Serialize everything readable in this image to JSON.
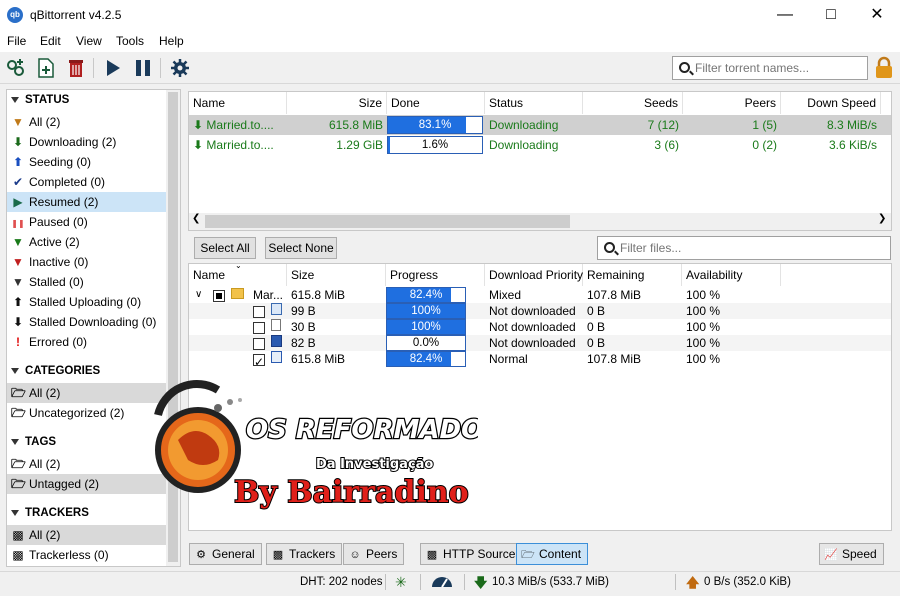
{
  "window": {
    "title": "qBittorrent v4.2.5",
    "app_icon": "qb"
  },
  "menu": [
    "File",
    "Edit",
    "View",
    "Tools",
    "Help"
  ],
  "toolbar": {
    "icons": [
      "add-torrent-link-icon",
      "add-torrent-file-icon",
      "delete-icon",
      "resume-icon",
      "pause-icon",
      "options-gear-icon"
    ],
    "search_placeholder": "Filter torrent names..."
  },
  "sidebar": {
    "status_header": "STATUS",
    "status_items": [
      {
        "label": "All (2)",
        "icon": "filter-icon",
        "color": "#c07a1a"
      },
      {
        "label": "Downloading (2)",
        "icon": "arrow-down-icon",
        "color": "#1a6a1a"
      },
      {
        "label": "Seeding (0)",
        "icon": "arrow-up-icon",
        "color": "#1a4fc0"
      },
      {
        "label": "Completed (0)",
        "icon": "check-icon",
        "color": "#1a3a8a"
      },
      {
        "label": "Resumed (2)",
        "icon": "play-icon",
        "color": "#1a6a4a"
      },
      {
        "label": "Paused (0)",
        "icon": "pause-icon",
        "color": "#e05050"
      },
      {
        "label": "Active (2)",
        "icon": "filter-icon",
        "color": "#1a7a1a"
      },
      {
        "label": "Inactive (0)",
        "icon": "filter-icon",
        "color": "#c02020"
      },
      {
        "label": "Stalled (0)",
        "icon": "filter-icon",
        "color": "#333333"
      },
      {
        "label": "Stalled Uploading (0)",
        "icon": "arrow-up-icon",
        "color": "#111111"
      },
      {
        "label": "Stalled Downloading (0)",
        "icon": "arrow-down-icon",
        "color": "#111111"
      },
      {
        "label": "Errored (0)",
        "icon": "exclamation-icon",
        "color": "#e01010"
      }
    ],
    "categories_header": "CATEGORIES",
    "categories_items": [
      "All (2)",
      "Uncategorized (2)"
    ],
    "tags_header": "TAGS",
    "tags_items": [
      "All (2)",
      "Untagged (2)"
    ],
    "trackers_header": "TRACKERS",
    "trackers_items": [
      "All (2)",
      "Trackerless (0)"
    ]
  },
  "torrents": {
    "columns": [
      "Name",
      "Size",
      "Done",
      "Status",
      "Seeds",
      "Peers",
      "Down Speed"
    ],
    "rows": [
      {
        "name": "Married.to....",
        "size": "615.8 MiB",
        "done": "83.1%",
        "done_value": 0.831,
        "status": "Downloading",
        "seeds": "7 (12)",
        "peers": "1 (5)",
        "down_speed": "8.3 MiB/s"
      },
      {
        "name": "Married.to....",
        "size": "1.29 GiB",
        "done": "1.6%",
        "done_value": 0.016,
        "status": "Downloading",
        "seeds": "3 (6)",
        "peers": "0 (2)",
        "down_speed": "3.6 KiB/s"
      }
    ]
  },
  "content_toolbar": {
    "select_all": "Select All",
    "select_none": "Select None",
    "filter_placeholder": "Filter files..."
  },
  "files": {
    "columns": [
      "Name",
      "Size",
      "Progress",
      "Download Priority",
      "Remaining",
      "Availability"
    ],
    "rows": [
      {
        "name": "Mar...",
        "size": "615.8 MiB",
        "progress": "82.4%",
        "progress_value": 0.824,
        "priority": "Mixed",
        "remaining": "107.8 MiB",
        "availability": "100 %"
      },
      {
        "name": "",
        "size": "99 B",
        "progress": "100%",
        "progress_value": 1.0,
        "priority": "Not downloaded",
        "remaining": "0 B",
        "availability": "100 %"
      },
      {
        "name": "",
        "size": "30 B",
        "progress": "100%",
        "progress_value": 1.0,
        "priority": "Not downloaded",
        "remaining": "0 B",
        "availability": "100 %"
      },
      {
        "name": "",
        "size": "82 B",
        "progress": "0.0%",
        "progress_value": 0.0,
        "priority": "Not downloaded",
        "remaining": "0 B",
        "availability": "100 %"
      },
      {
        "name": "",
        "size": "615.8 MiB",
        "progress": "82.4%",
        "progress_value": 0.824,
        "priority": "Normal",
        "remaining": "107.8 MiB",
        "availability": "100 %"
      }
    ]
  },
  "tabs": [
    "General",
    "Trackers",
    "Peers",
    "HTTP Sources",
    "Content"
  ],
  "speed_button": "Speed",
  "statusbar": {
    "dht": "DHT: 202 nodes",
    "download": "10.3 MiB/s (533.7 MiB)",
    "upload": "0 B/s (352.0 KiB)"
  },
  "watermark": {
    "line1": "OS REFORMADOS",
    "line2": "Da Investigação",
    "line3": "By Bairradino"
  },
  "colors": {
    "accent": "#1f6fe0",
    "selection": "#cce4f7",
    "download_green": "#1a7a1a",
    "upload_orange": "#c06a10"
  }
}
